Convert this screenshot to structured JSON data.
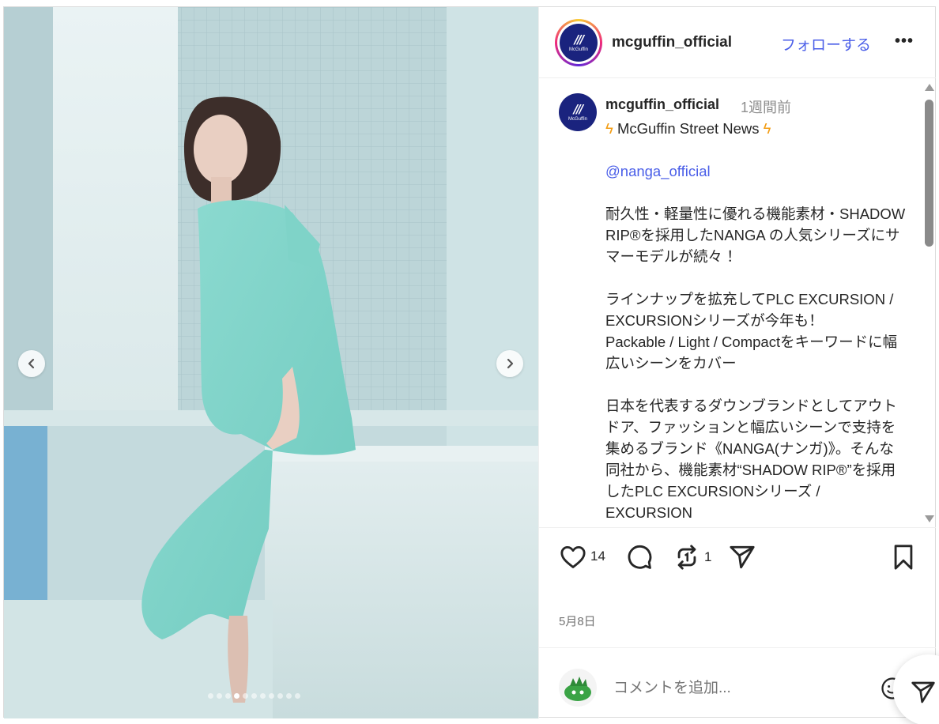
{
  "account": {
    "username": "mcguffin_official",
    "logo_text": "McGuffin"
  },
  "header": {
    "follow_label": "フォローする",
    "more_label": "•••"
  },
  "post": {
    "time_ago": "1週間前",
    "caption_title": "McGuffin Street News",
    "mention": "@nanga_official",
    "caption_p1": "耐久性・軽量性に優れる機能素材・SHADOW RIP®を採用したNANGA の人気シリーズにサマーモデルが続々 ！",
    "caption_p2": "ラインナップを拡充してPLC EXCURSION / EXCURSIONシリーズが今年も！\nPackable / Light / Compactをキーワードに幅広いシーンをカバー",
    "caption_p3": "日本を代表するダウンブランドとしてアウトドア、ファッションと幅広いシーンで支持を集めるブランド《NANGA(ナンガ)》。そんな同社から、機能素材“SHADOW RIP®”を採用したPLC EXCURSIONシリーズ / EXCURSION",
    "likes": "14",
    "reposts": "1",
    "date": "5月8日"
  },
  "comment": {
    "placeholder": "コメントを追加..."
  },
  "carousel": {
    "total": 11,
    "active_index": 3
  },
  "colors": {
    "accent": "#4a5ee8",
    "brand": "#1a237e",
    "bolt": "#f39c12"
  }
}
